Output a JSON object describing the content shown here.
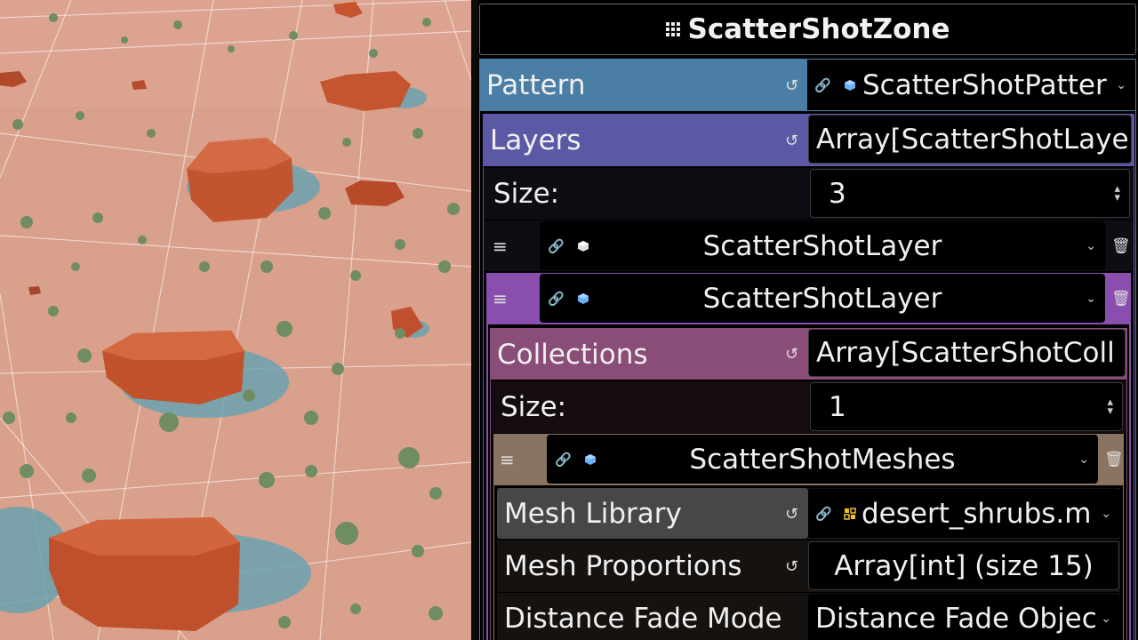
{
  "inspector": {
    "title": "ScatterShotZone",
    "pattern": {
      "label": "Pattern",
      "value": "ScatterShotPatter"
    },
    "layers": {
      "label": "Layers",
      "value": "Array[ScatterShotLaye"
    },
    "layers_size": {
      "label": "Size:",
      "value": "3"
    },
    "layer_items": [
      {
        "label": "ScatterShotLayer"
      },
      {
        "label": "ScatterShotLayer"
      }
    ],
    "collections": {
      "label": "Collections",
      "value": "Array[ScatterShotColl"
    },
    "collections_size": {
      "label": "Size:",
      "value": "1"
    },
    "collection_item": {
      "label": "ScatterShotMeshes"
    },
    "mesh_library": {
      "label": "Mesh Library",
      "value": "desert_shrubs.m"
    },
    "mesh_proportions": {
      "label": "Mesh Proportions",
      "value": "Array[int] (size 15)"
    },
    "distance_fade_mode": {
      "label": "Distance Fade Mode",
      "value": "Distance Fade Objec"
    }
  },
  "colors": {
    "pattern_bg": "#4a7ea5",
    "layers_bg": "#5b59a5",
    "layer_selected_bg": "#8a4eae",
    "collections_bg": "#8a4d77",
    "meshes_bg": "#8a7360",
    "mesh_library_bg": "#474747",
    "cube_icon": "#6ab0ff",
    "mesh_icon": "#f0c020",
    "sand": "#d9a08c",
    "rock": "#c0502e",
    "shadow": "#6aa2b0"
  },
  "icons": [
    "grid-icon",
    "revert-icon",
    "link-icon",
    "cube-icon",
    "chevron-down-icon",
    "spinner-icon",
    "drag-handle-icon",
    "trash-icon",
    "mesh-library-icon"
  ]
}
